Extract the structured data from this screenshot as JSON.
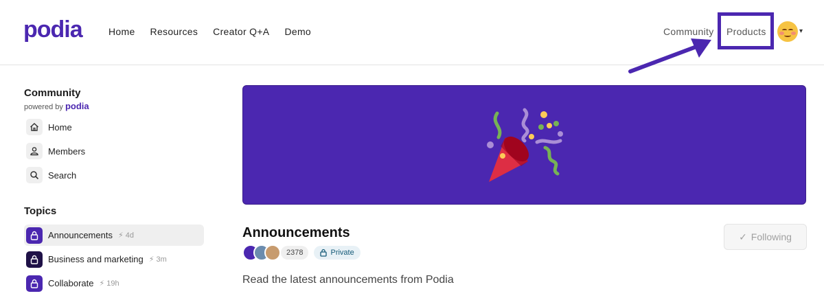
{
  "header": {
    "logo": "podia",
    "nav": [
      "Home",
      "Resources",
      "Creator Q+A",
      "Demo"
    ],
    "community": "Community",
    "products": "Products"
  },
  "sidebar": {
    "title": "Community",
    "powered_by": "powered by",
    "powered_brand": "podia",
    "items": [
      {
        "label": "Home",
        "icon": "home-icon"
      },
      {
        "label": "Members",
        "icon": "person-icon"
      },
      {
        "label": "Search",
        "icon": "search-icon"
      }
    ],
    "topics_heading": "Topics",
    "topics": [
      {
        "label": "Announcements",
        "meta": "4d",
        "color": "#4b27b0"
      },
      {
        "label": "Business and marketing",
        "meta": "3m",
        "color": "#1f1147"
      },
      {
        "label": "Collaborate",
        "meta": "19h",
        "color": "#4b27b0"
      }
    ]
  },
  "main": {
    "title": "Announcements",
    "following_label": "Following",
    "member_count": "2378",
    "private_label": "Private",
    "description": "Read the latest announcements from Podia"
  },
  "colors": {
    "brand": "#4b27b0",
    "banner": "#4b27b0"
  }
}
